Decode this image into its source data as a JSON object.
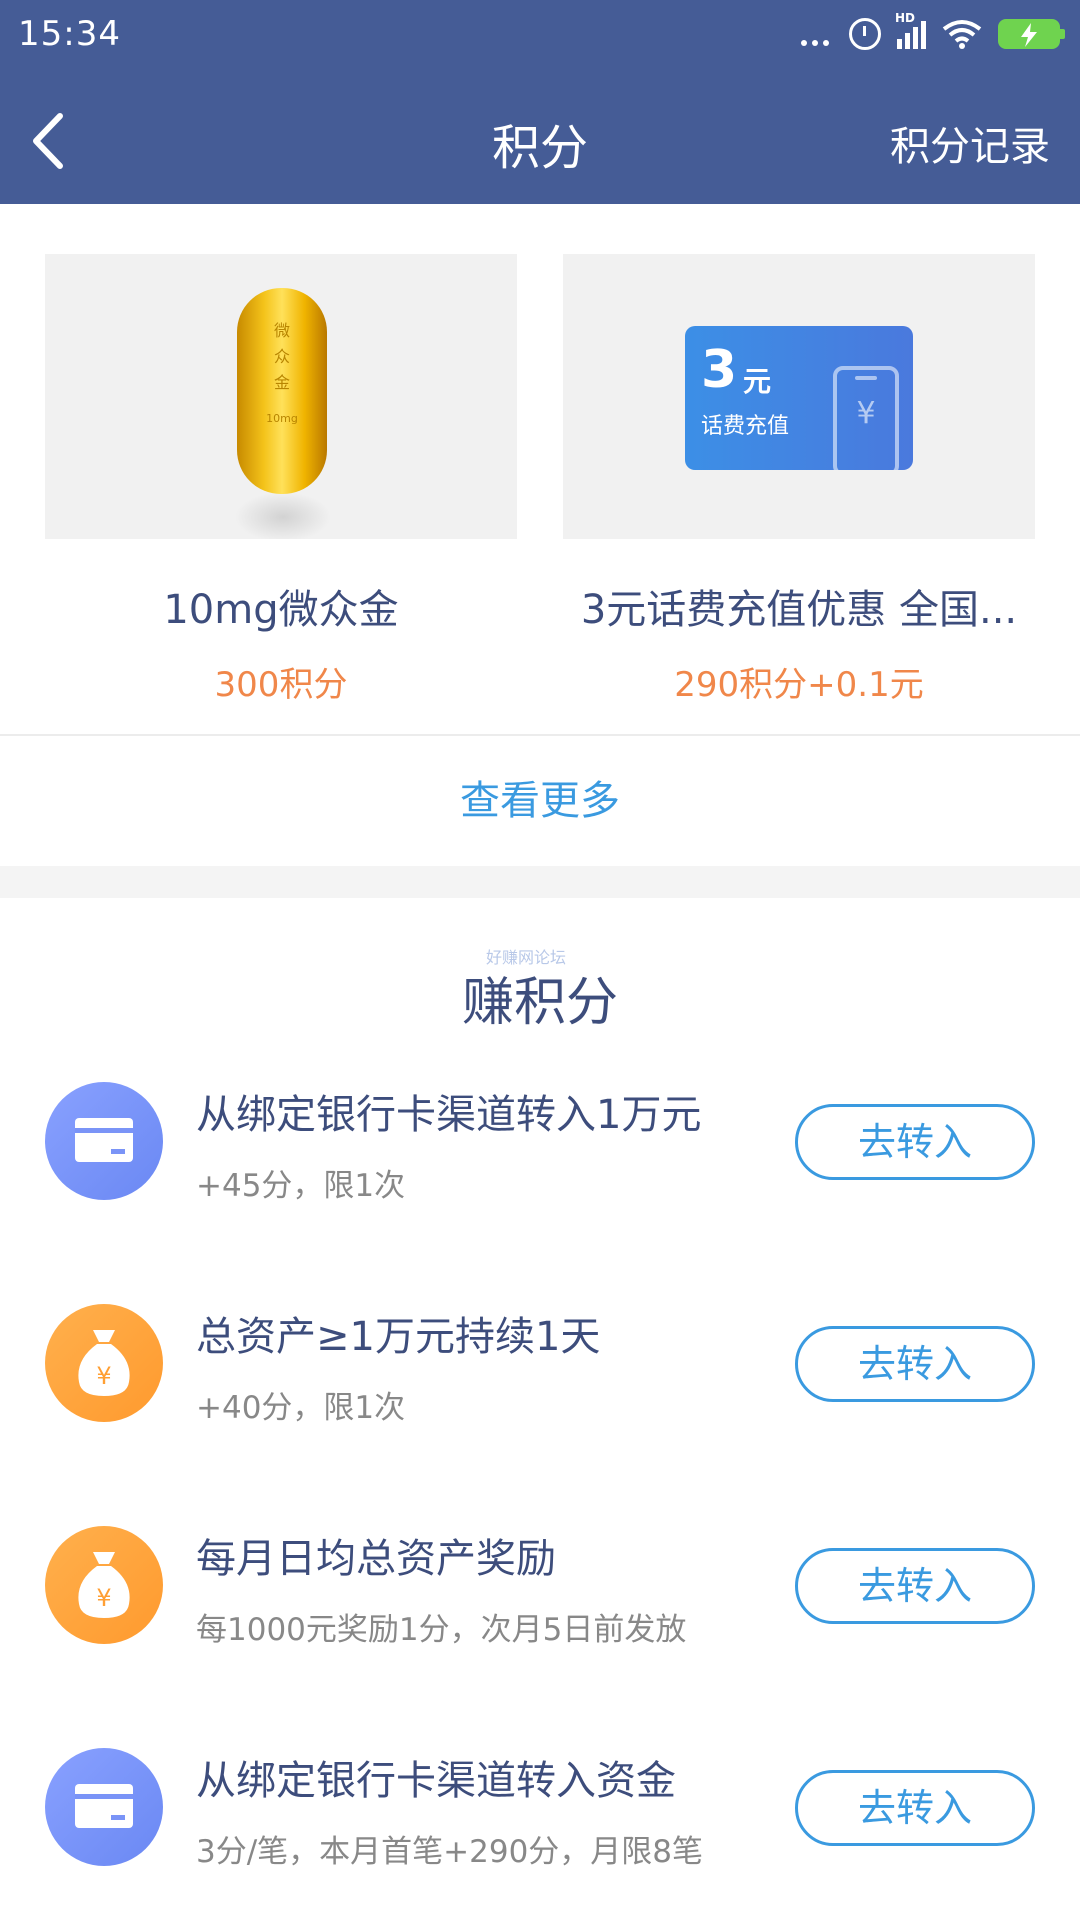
{
  "status_bar": {
    "time": "15:34",
    "network_label": "HD"
  },
  "header": {
    "title": "积分",
    "right_link": "积分记录"
  },
  "products": [
    {
      "name": "10mg微众金",
      "price": "300积分",
      "image": {
        "engraving": [
          "微",
          "众",
          "金"
        ],
        "weight": "10mg"
      }
    },
    {
      "name": "3元话费充值优惠 全国...",
      "price": "290积分+0.1元",
      "image": {
        "amount": "3",
        "unit": "元",
        "desc": "话费充值",
        "symbol": "¥"
      }
    }
  ],
  "more_label": "查看更多",
  "earn": {
    "title": "赚积分",
    "watermark": "好赚网论坛",
    "tasks": [
      {
        "icon": "bank-card-icon",
        "title": "从绑定银行卡渠道转入1万元",
        "sub": "+45分，限1次",
        "button": "去转入"
      },
      {
        "icon": "money-bag-icon",
        "title": "总资产≥1万元持续1天",
        "sub": "+40分，限1次",
        "button": "去转入"
      },
      {
        "icon": "money-bag-icon",
        "title": "每月日均总资产奖励",
        "sub": "每1000元奖励1分，次月5日前发放",
        "button": "去转入"
      },
      {
        "icon": "bank-card-icon",
        "title": "从绑定银行卡渠道转入资金",
        "sub": "3分/笔，本月首笔+290分，月限8笔",
        "button": "去转入"
      }
    ]
  },
  "colors": {
    "header_bg": "#455c96",
    "accent_blue": "#3a9ae0",
    "price_orange": "#f0874a",
    "title_navy": "#3d4d7c"
  }
}
